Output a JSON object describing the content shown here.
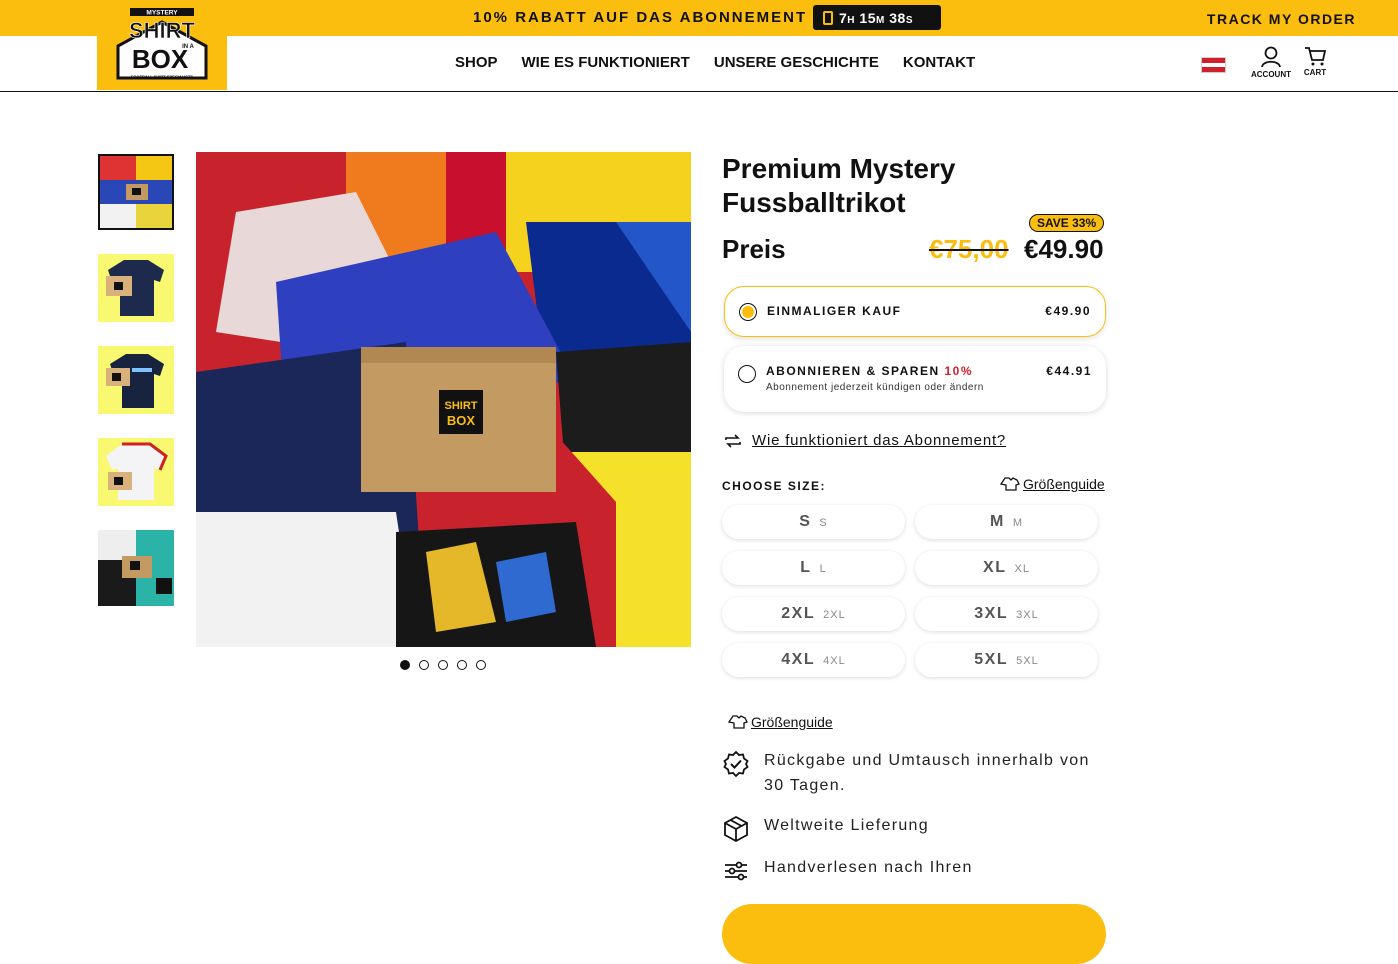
{
  "topbar": {
    "promo": "10% RABATT AUF DAS ABONNEMENT",
    "timer": {
      "h": "7",
      "m": "15",
      "s": "38",
      "h_unit": "H",
      "m_unit": "M",
      "s_unit": "S"
    },
    "track": "TRACK MY ORDER"
  },
  "logo": {
    "top": "MYSTERY",
    "line1": "SHIRT",
    "inabox": "IN A",
    "line2": "BOX",
    "tagline": "FOOTBALL SHIRT SPECIALISTS"
  },
  "nav": [
    "SHOP",
    "WIE ES FUNKTIONIERT",
    "UNSERE GESCHICHTE",
    "KONTAKT"
  ],
  "header_icons": {
    "account": "ACCOUNT",
    "cart": "CART"
  },
  "colors": {
    "accent": "#fbbd0e",
    "text": "#111111",
    "sub_red": "#d0202a"
  },
  "product": {
    "title": "Premium Mystery Fussballtrikot",
    "price_label": "Preis",
    "old_price": "€75,00",
    "new_price": "€49.90",
    "save_badge": "SAVE 33%",
    "box_label": {
      "l1": "SHIRT",
      "l2": "BOX"
    }
  },
  "purchase_options": [
    {
      "label": "EINMALIGER KAUF",
      "price": "€49.90",
      "selected": true
    },
    {
      "label": "ABONNIEREN & SPAREN",
      "highlight": "10%",
      "price": "€44.91",
      "sub": "Abonnement jederzeit kündigen oder ändern",
      "selected": false
    }
  ],
  "subscription_link": "Wie funktioniert das Abonnement?",
  "size": {
    "label": "CHOOSE SIZE:",
    "guide": "Größenguide",
    "options": [
      {
        "main": "S",
        "sub": "S"
      },
      {
        "main": "M",
        "sub": "M"
      },
      {
        "main": "L",
        "sub": "L"
      },
      {
        "main": "XL",
        "sub": "XL"
      },
      {
        "main": "2XL",
        "sub": "2XL"
      },
      {
        "main": "3XL",
        "sub": "3XL"
      },
      {
        "main": "4XL",
        "sub": "4XL"
      },
      {
        "main": "5XL",
        "sub": "5XL"
      }
    ]
  },
  "guide_link": "Größenguide",
  "features": [
    {
      "icon": "badge-check-icon",
      "text": "Rückgabe und Umtausch innerhalb von 30 Tagen."
    },
    {
      "icon": "package-icon",
      "text": "Weltweite Lieferung"
    },
    {
      "icon": "sliders-icon",
      "text": "Handverlesen nach Ihren"
    }
  ],
  "gallery": {
    "thumbnails": 5,
    "active_index": 0
  }
}
